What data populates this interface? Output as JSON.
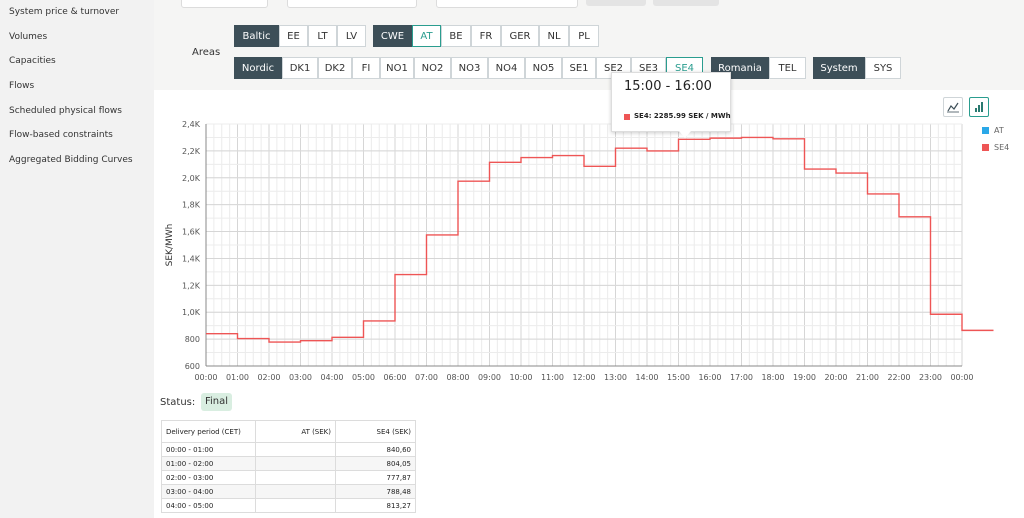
{
  "sidebar": {
    "items": [
      "System price & turnover",
      "Volumes",
      "Capacities",
      "Flows",
      "Scheduled physical flows",
      "Flow-based constraints",
      "Aggregated Bidding Curves"
    ]
  },
  "areas": {
    "label": "Areas",
    "row1": {
      "group1": [
        "Baltic",
        "EE",
        "LT",
        "LV"
      ],
      "group2": [
        "CWE",
        "AT",
        "BE",
        "FR",
        "GER",
        "NL",
        "PL"
      ]
    },
    "row2": {
      "group1": [
        "Nordic",
        "DK1",
        "DK2",
        "FI",
        "NO1",
        "NO2",
        "NO3",
        "NO4",
        "NO5",
        "SE1",
        "SE2",
        "SE3",
        "SE4"
      ],
      "group2": [
        "Romania",
        "TEL"
      ],
      "group3": [
        "System",
        "SYS"
      ]
    }
  },
  "tooltip": {
    "time": "15:00 - 16:00",
    "value": "SE4: 2285.99 SEK / MWh",
    "color": "#ee5555"
  },
  "chart_tools": [
    "line-chart-icon",
    "bar-chart-icon"
  ],
  "chart_data": {
    "type": "line",
    "step": true,
    "ylabel": "SEK/MWh",
    "xlabel": "",
    "ylim": [
      600,
      2400
    ],
    "yticks": [
      "600",
      "800",
      "1,0K",
      "1,2K",
      "1,4K",
      "1,6K",
      "1,8K",
      "2,0K",
      "2,2K",
      "2,4K"
    ],
    "yticks_values": [
      600,
      800,
      1000,
      1200,
      1400,
      1600,
      1800,
      2000,
      2200,
      2400
    ],
    "categories": [
      "00:00",
      "01:00",
      "02:00",
      "03:00",
      "04:00",
      "05:00",
      "06:00",
      "07:00",
      "08:00",
      "09:00",
      "10:00",
      "11:00",
      "12:00",
      "13:00",
      "14:00",
      "15:00",
      "16:00",
      "17:00",
      "18:00",
      "19:00",
      "20:00",
      "21:00",
      "22:00",
      "23:00",
      "00:00"
    ],
    "grid": true,
    "legend_position": "top-right",
    "series": [
      {
        "name": "AT",
        "color": "#2aa8e8",
        "values": []
      },
      {
        "name": "SE4",
        "color": "#ee5555",
        "values": [
          840.6,
          804.05,
          777.87,
          788.48,
          813.27,
          935,
          1280,
          1575,
          1975,
          2115,
          2150,
          2165,
          2085,
          2220,
          2200,
          2285.99,
          2295,
          2300,
          2290,
          2065,
          2035,
          1880,
          1710,
          985,
          865
        ]
      }
    ]
  },
  "status": {
    "label": "Status:",
    "value": "Final"
  },
  "table": {
    "headers": [
      "Delivery period (CET)",
      "AT (SEK)",
      "SE4 (SEK)"
    ],
    "rows": [
      [
        "00:00 - 01:00",
        "",
        "840,60"
      ],
      [
        "01:00 - 02:00",
        "",
        "804,05"
      ],
      [
        "02:00 - 03:00",
        "",
        "777,87"
      ],
      [
        "03:00 - 04:00",
        "",
        "788,48"
      ],
      [
        "04:00 - 05:00",
        "",
        "813,27"
      ]
    ]
  }
}
